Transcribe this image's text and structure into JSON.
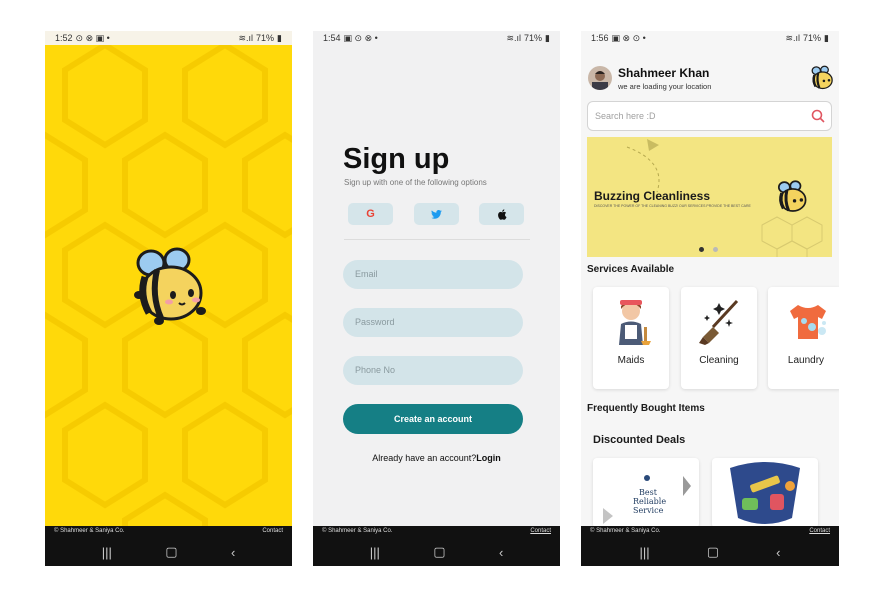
{
  "splash": {
    "status_time": "1:52",
    "status_battery": "71%",
    "footer_left": "© Shahmeer & Saniya Co.",
    "footer_right": "Contact"
  },
  "signup": {
    "status_time": "1:54",
    "status_battery": "71%",
    "title": "Sign up",
    "subtitle": "Sign up with one of the following options",
    "social_buttons": [
      {
        "icon": "google-icon",
        "glyph": "G",
        "color": "#e94235"
      },
      {
        "icon": "twitter-icon",
        "glyph": "t",
        "color": "#1d9bf0"
      },
      {
        "icon": "apple-icon",
        "glyph": "●",
        "color": "#111111"
      }
    ],
    "email_placeholder": "Email",
    "password_placeholder": "Password",
    "phone_placeholder": "Phone No",
    "create_button": "Create an account",
    "already_text": "Already have an account?",
    "login_link": "Login",
    "footer_left": "© Shahmeer & Saniya Co.",
    "footer_right": "Contact"
  },
  "home": {
    "status_time": "1:56",
    "status_battery": "71%",
    "user_name": "Shahmeer Khan",
    "user_location": "we are loading your location",
    "search_placeholder": "Search here :D",
    "banner_title": "Buzzing Cleanliness",
    "banner_subtitle": "DISCOVER THE POWER OF THE CLEANING BUZZ! OUR SERVICES PROVIDE THE BEST CARE",
    "banner_page": 1,
    "banner_pages": 2,
    "services_title": "Services Available",
    "services": [
      {
        "label": "Maids",
        "icon": "maid-icon"
      },
      {
        "label": "Cleaning",
        "icon": "broom-icon"
      },
      {
        "label": "Laundry",
        "icon": "tshirt-icon"
      }
    ],
    "frequent_title": "Frequently Bought Items",
    "deals_title": "Discounted Deals",
    "deal1_text": "Best Reliable Service",
    "footer_left": "© Shahmeer & Saniya Co.",
    "footer_right": "Contact"
  },
  "colors": {
    "splash_yellow": "#ffd90a",
    "teal": "#157f85",
    "field_bg": "#d3e4e9",
    "banner_yellow": "#f3e582"
  }
}
